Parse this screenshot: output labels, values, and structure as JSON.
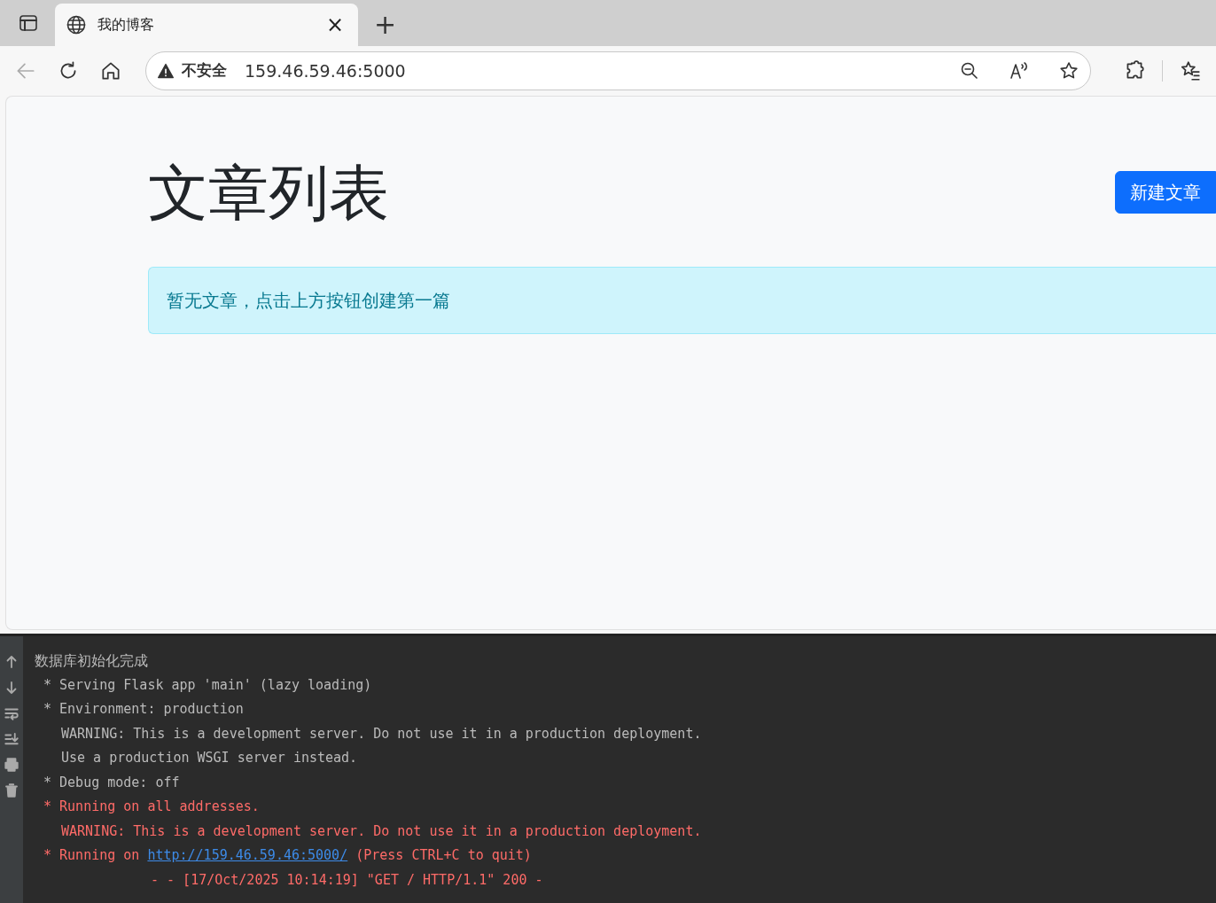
{
  "tabs": [
    {
      "title": "我的博客",
      "selected": true,
      "close": "×"
    }
  ],
  "new_tab": "+",
  "address_bar": {
    "security": "不安全",
    "url": "159.46.59.46:5000"
  },
  "page": {
    "heading": "文章列表",
    "new_button": "新建文章",
    "alert": "暂无文章，点击上方按钮创建第一篇"
  },
  "console": {
    "lines": [
      {
        "kind": "plain",
        "color": "#bbbbbb",
        "text": "数据库初始化完成"
      },
      {
        "kind": "bullet",
        "color": "#bbbbbb",
        "text": "* Serving Flask app 'main' (lazy loading)"
      },
      {
        "kind": "bullet",
        "color": "#bbbbbb",
        "text": "* Environment: production"
      },
      {
        "kind": "cont",
        "color": "#bbbbbb",
        "text": "WARNING: This is a development server. Do not use it in a production deployment."
      },
      {
        "kind": "cont",
        "color": "#bbbbbb",
        "text": "Use a production WSGI server instead."
      },
      {
        "kind": "bullet",
        "color": "#bbbbbb",
        "text": "* Debug mode: off"
      },
      {
        "kind": "bullet",
        "color": "#ff6b68",
        "text": "* Running on all addresses."
      },
      {
        "kind": "cont",
        "color": "#ff6b68",
        "text": "WARNING: This is a development server. Do not use it in a production deployment."
      },
      {
        "kind": "bullet",
        "color": "#ff6b68",
        "text": "* Running on ",
        "link": "http://159.46.59.46:5000/",
        "after": " (Press CTRL+C to quit)"
      },
      {
        "kind": "request",
        "color": "#ff6b68",
        "text": "- - [17/Oct/2025 10:14:19] \"GET / HTTP/1.1\" 200 -"
      }
    ]
  }
}
